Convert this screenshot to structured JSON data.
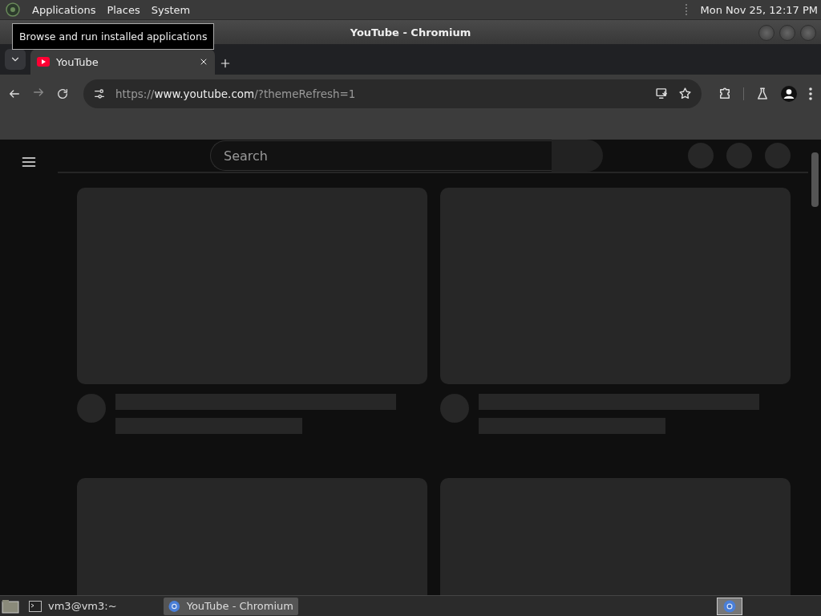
{
  "top_panel": {
    "menus": [
      "Applications",
      "Places",
      "System"
    ],
    "clock": "Mon Nov 25, 12:17 PM"
  },
  "tooltip": "Browse and run installed applications",
  "window": {
    "title": "YouTube - Chromium"
  },
  "tabs": [
    {
      "title": "YouTube",
      "selected": true
    }
  ],
  "address_bar": {
    "scheme": "https://",
    "host": "www.youtube.com",
    "path": "/?themeRefresh=1"
  },
  "page": {
    "search": {
      "placeholder": "Search"
    }
  },
  "taskbar": {
    "items": [
      {
        "label": "vm3@vm3:~",
        "kind": "terminal",
        "selected": false
      },
      {
        "label": "YouTube - Chromium",
        "kind": "browser",
        "selected": true
      }
    ]
  }
}
